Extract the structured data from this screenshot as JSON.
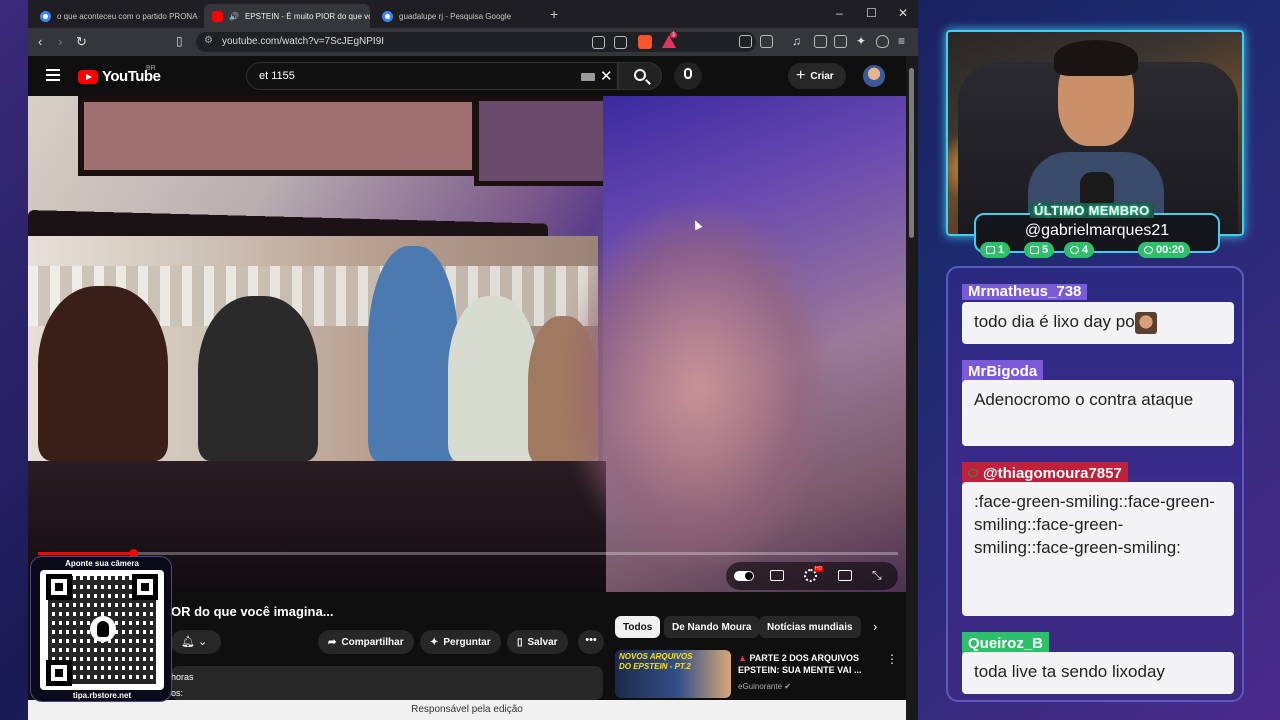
{
  "browser": {
    "tabs": [
      {
        "title": "o que aconteceu com o partido PRONA - Pe",
        "active": false
      },
      {
        "title": "EPSTEIN - É muito PIOR do que voc",
        "active": true
      },
      {
        "title": "guadalupe rj - Pesquisa Google",
        "active": false
      }
    ],
    "new_tab": "+",
    "window_controls": [
      "–",
      "☐",
      "✕"
    ],
    "url": "youtube.com/watch?v=7ScJEgNPI9I",
    "status_text": "Responsável pela edição",
    "brave_badge": "1"
  },
  "youtube": {
    "logo": "YouTube",
    "region": "BR",
    "search_value": "et 1155",
    "create_label": "Criar",
    "video": {
      "progress_fraction": 0.11,
      "title_visible": "OR do que você imagina...",
      "actions": {
        "share": "Compartilhar",
        "ask": "Perguntar",
        "save": "Salvar",
        "more": "•••"
      },
      "description_line1": "horas",
      "description_line2": "os:"
    },
    "chips": [
      "Todos",
      "De Nando Moura",
      "Notícias mundiais"
    ],
    "recommendation": {
      "thumb_text1": "NOVOS ARQUIVOS",
      "thumb_text2": "DO EPSTEIN - PT.2",
      "title": "PARTE 2 DOS ARQUIVOS EPSTEIN: SUA MENTE VAI ...",
      "channel": "eGuinorante"
    }
  },
  "overlay_qr": {
    "top_text": "Aponte sua câmera",
    "bottom_text": "tipa.rbstore.net"
  },
  "stream": {
    "member_label": "ÚLTIMO MEMBRO",
    "member_name": "@gabrielmarques21",
    "stats": [
      {
        "icon": "chat-icon",
        "value": "1"
      },
      {
        "icon": "youtube-icon",
        "value": "5"
      },
      {
        "icon": "refresh-icon",
        "value": "4"
      },
      {
        "icon": "clock-icon",
        "value": "00:20"
      }
    ]
  },
  "chat": {
    "messages": [
      {
        "user": "Mrmatheus_738",
        "user_color": "#7a5ad8",
        "text": "todo dia é lixo day po"
      },
      {
        "user": "MrBigoda",
        "user_color": "#7a5ad8",
        "text": "Adenocromo o contra ataque"
      },
      {
        "user": "@thiagomoura7857",
        "user_color": "#c0203a",
        "text": ":face-green-smiling::face-green-smiling::face-green-smiling::face-green-smiling:"
      },
      {
        "user": "Queiroz_B",
        "user_color": "#2cc06a",
        "text": "toda live ta sendo lixoday"
      }
    ]
  }
}
